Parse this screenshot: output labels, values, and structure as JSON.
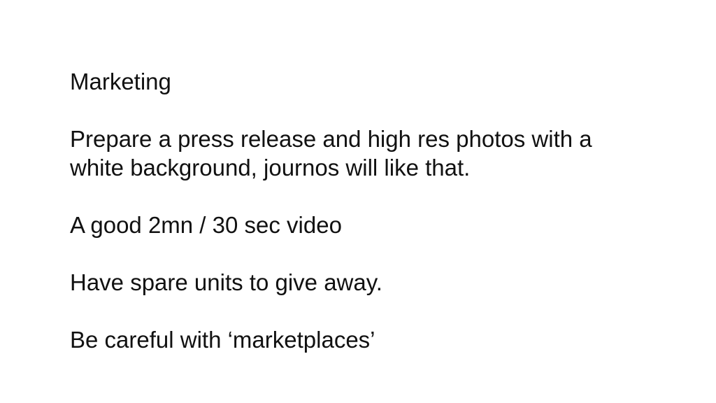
{
  "slide": {
    "title": "Marketing",
    "paragraphs": [
      {
        "line1": "Prepare a press release and high res photos with a",
        "line2": "white background, journos will like that."
      },
      {
        "text": "A good 2mn / 30 sec video"
      },
      {
        "text": "Have spare units to give away."
      },
      {
        "text": "Be careful with ‘marketplaces’"
      }
    ]
  }
}
